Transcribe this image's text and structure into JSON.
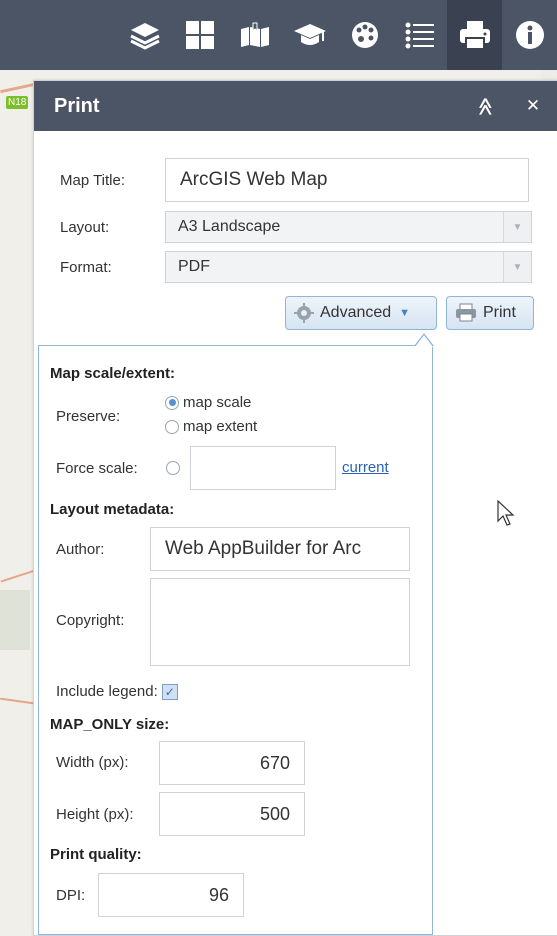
{
  "toolbar": {
    "icons": [
      "layers-icon",
      "basemap-grid-icon",
      "bookmark-icon",
      "education-icon",
      "palette-icon",
      "legend-list-icon",
      "print-icon",
      "info-icon"
    ],
    "active": "print-icon"
  },
  "map": {
    "road_label": "N18"
  },
  "panel": {
    "title": "Print",
    "collapse_glyph": "≫",
    "close_glyph": "✕"
  },
  "form": {
    "map_title_label": "Map Title:",
    "map_title_value": "ArcGIS Web Map",
    "layout_label": "Layout:",
    "layout_value": "A3 Landscape",
    "format_label": "Format:",
    "format_value": "PDF",
    "advanced_label": "Advanced",
    "print_label": "Print"
  },
  "advanced": {
    "scale_heading": "Map scale/extent:",
    "preserve_label": "Preserve:",
    "option_scale": "map scale",
    "option_extent": "map extent",
    "selected": "map scale",
    "force_scale_label": "Force scale:",
    "force_scale_value": "",
    "current_link": "current",
    "metadata_heading": "Layout metadata:",
    "author_label": "Author:",
    "author_value": "Web AppBuilder for Arc",
    "copyright_label": "Copyright:",
    "copyright_value": "",
    "legend_label": "Include legend:",
    "legend_checked": true,
    "size_heading": "MAP_ONLY size:",
    "width_label": "Width (px):",
    "width_value": "670",
    "height_label": "Height (px):",
    "height_value": "500",
    "quality_heading": "Print quality:",
    "dpi_label": "DPI:",
    "dpi_value": "96"
  },
  "colors": {
    "header_bg": "#4c5566",
    "toolbar_active": "#3a4150",
    "link": "#2a62b6",
    "accent_border": "#8fb5d8"
  }
}
